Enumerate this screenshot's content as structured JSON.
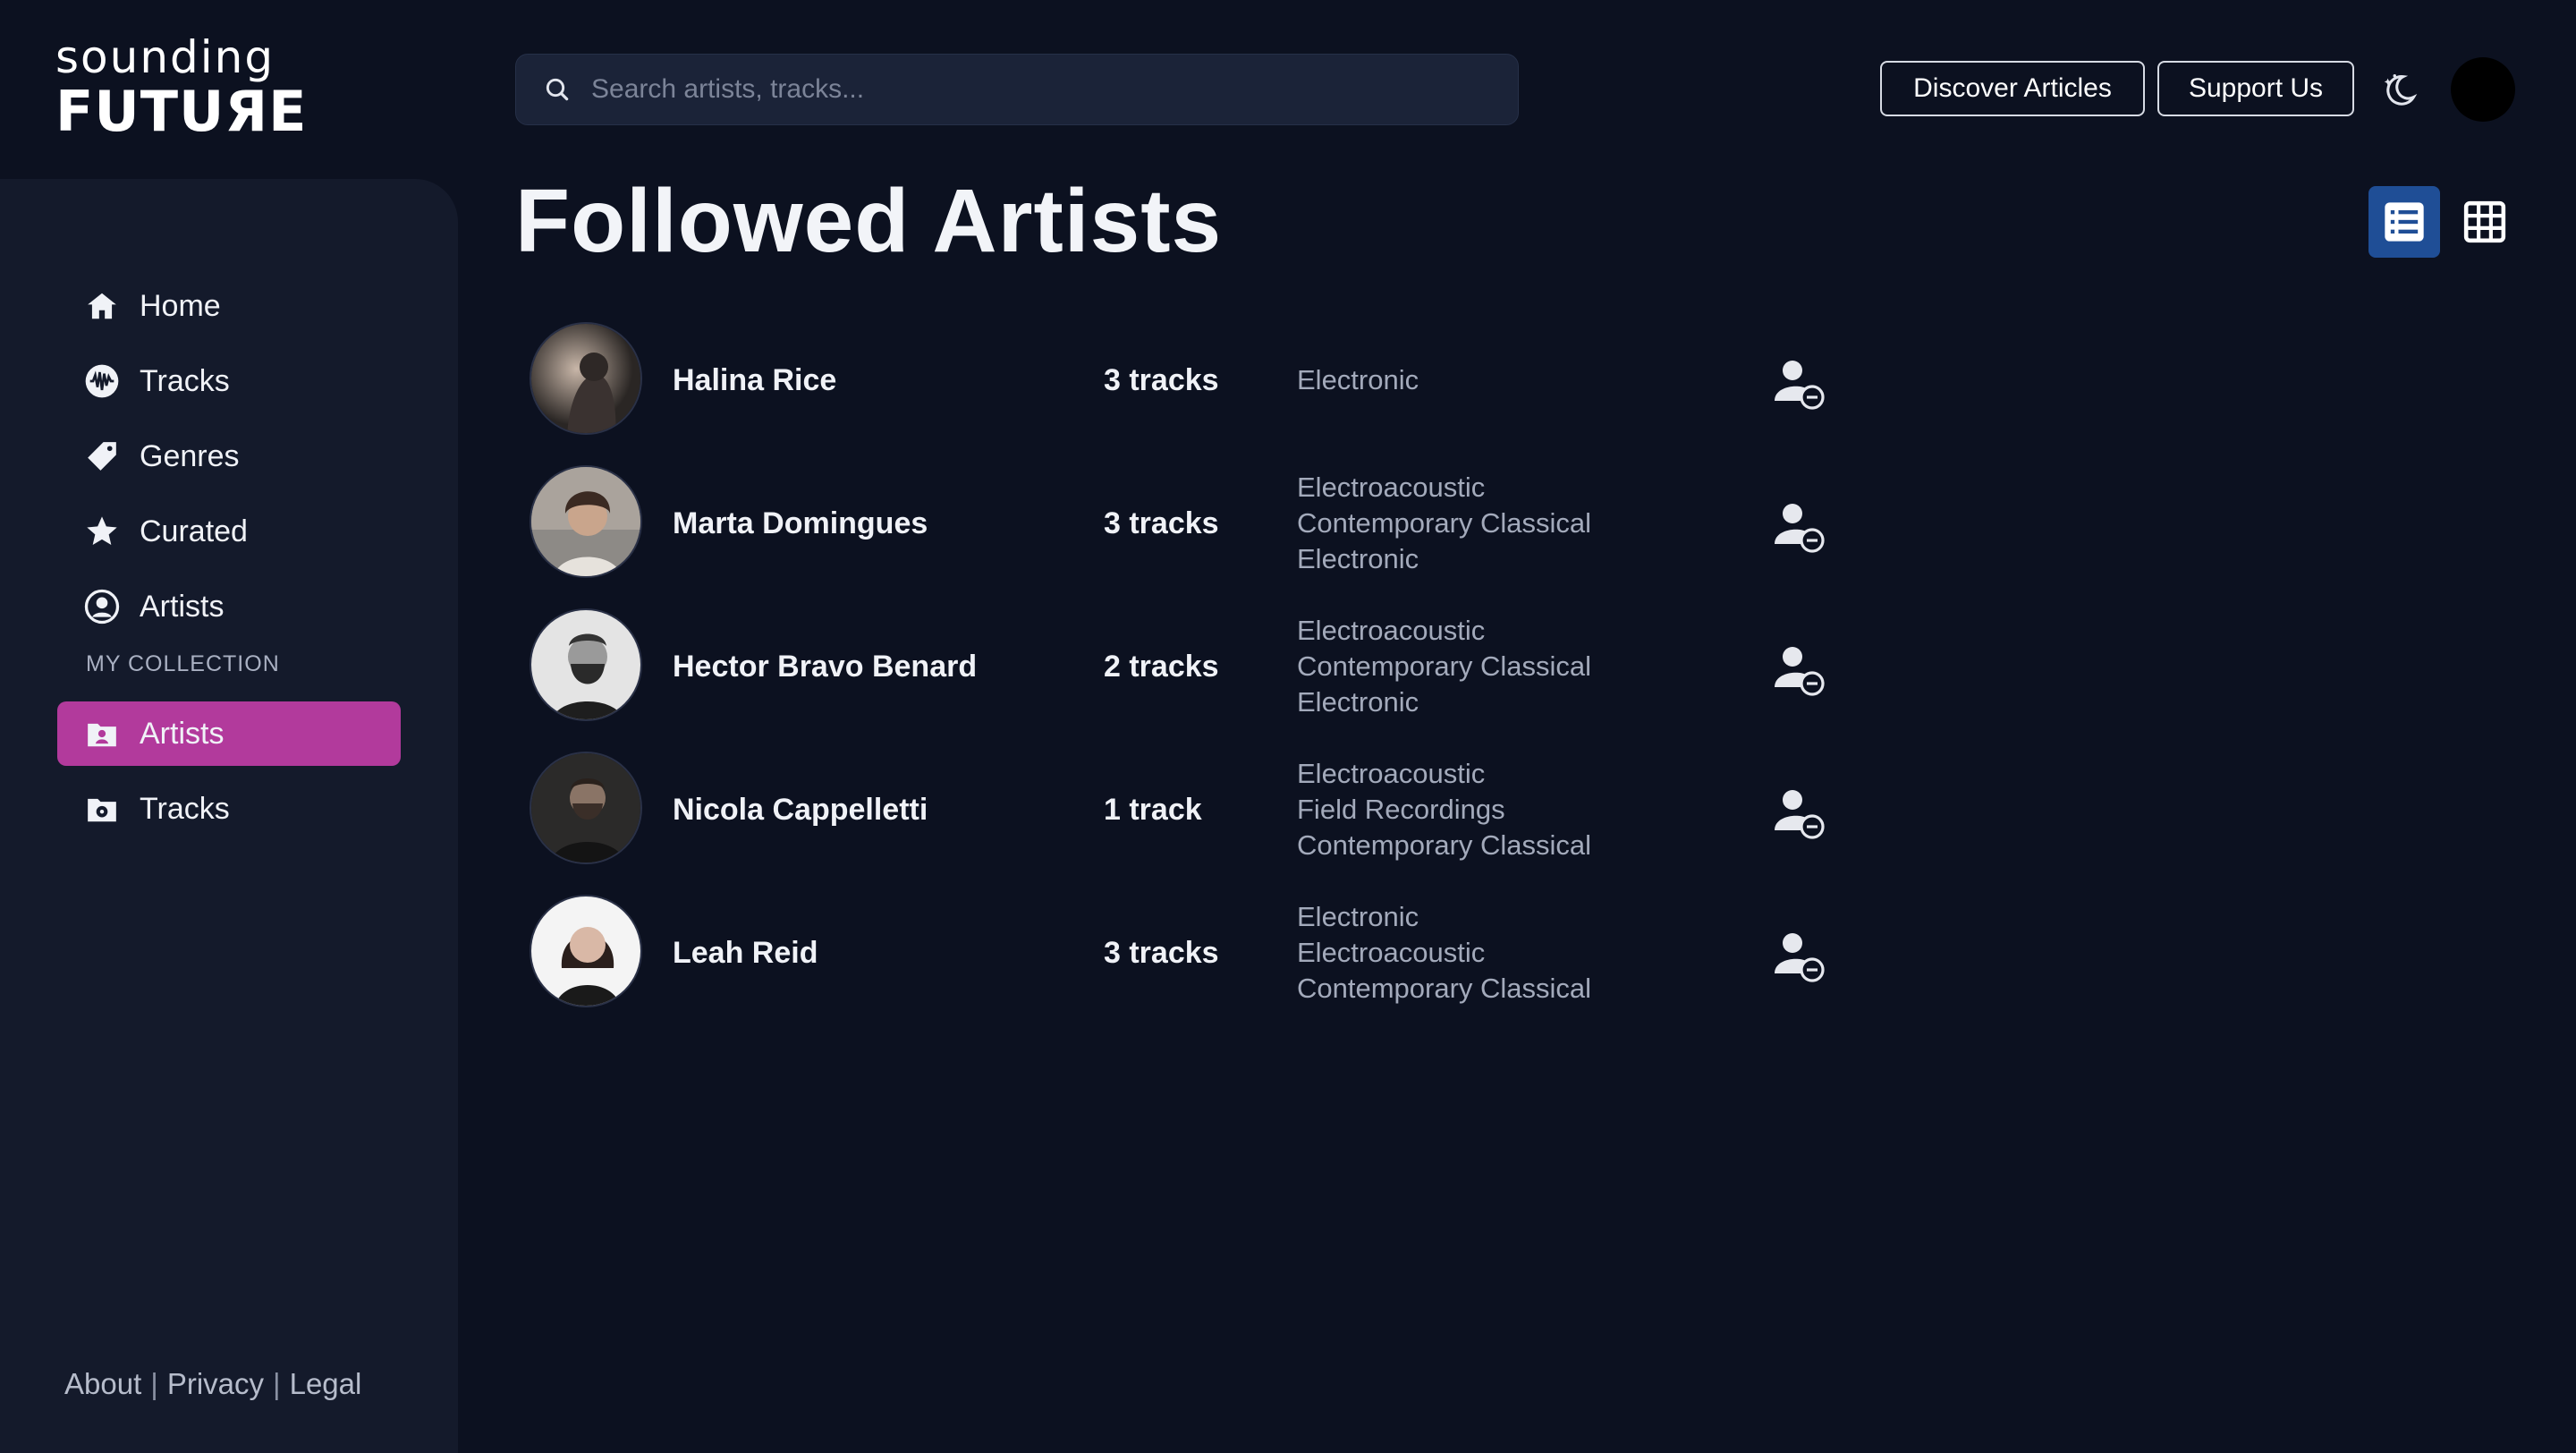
{
  "brand": {
    "line1": "sounding",
    "line2": "FUTUЯE"
  },
  "search": {
    "placeholder": "Search artists, tracks..."
  },
  "header": {
    "discover_label": "Discover Articles",
    "support_label": "Support Us"
  },
  "page": {
    "title": "Followed Artists"
  },
  "sidebar": {
    "nav": [
      {
        "label": "Home",
        "icon": "home-icon"
      },
      {
        "label": "Tracks",
        "icon": "soundwave-icon"
      },
      {
        "label": "Genres",
        "icon": "tag-icon"
      },
      {
        "label": "Curated",
        "icon": "star-icon"
      },
      {
        "label": "Artists",
        "icon": "user-circle-icon"
      }
    ],
    "collection_label": "MY COLLECTION",
    "collection": [
      {
        "label": "Artists",
        "icon": "folder-user-icon",
        "active": true
      },
      {
        "label": "Tracks",
        "icon": "folder-music-icon",
        "active": false
      }
    ],
    "footer": {
      "about": "About",
      "privacy": "Privacy",
      "legal": "Legal",
      "separator": "|"
    }
  },
  "artists": [
    {
      "name": "Halina Rice",
      "tracks": "3 tracks",
      "genres": [
        "Electronic"
      ]
    },
    {
      "name": "Marta Domingues",
      "tracks": "3 tracks",
      "genres": [
        "Electroacoustic",
        "Contemporary Classical",
        "Electronic"
      ]
    },
    {
      "name": "Hector Bravo Benard",
      "tracks": "2 tracks",
      "genres": [
        "Electroacoustic",
        "Contemporary Classical",
        "Electronic"
      ]
    },
    {
      "name": "Nicola Cappelletti",
      "tracks": "1 track",
      "genres": [
        "Electroacoustic",
        "Field Recordings",
        "Contemporary Classical"
      ]
    },
    {
      "name": "Leah Reid",
      "tracks": "3 tracks",
      "genres": [
        "Electronic",
        "Electroacoustic",
        "Contemporary Classical"
      ]
    }
  ],
  "colors": {
    "background": "#0c1120",
    "sidebar": "#141a2b",
    "accent": "#b23a9c",
    "view_active": "#1f4e96"
  }
}
